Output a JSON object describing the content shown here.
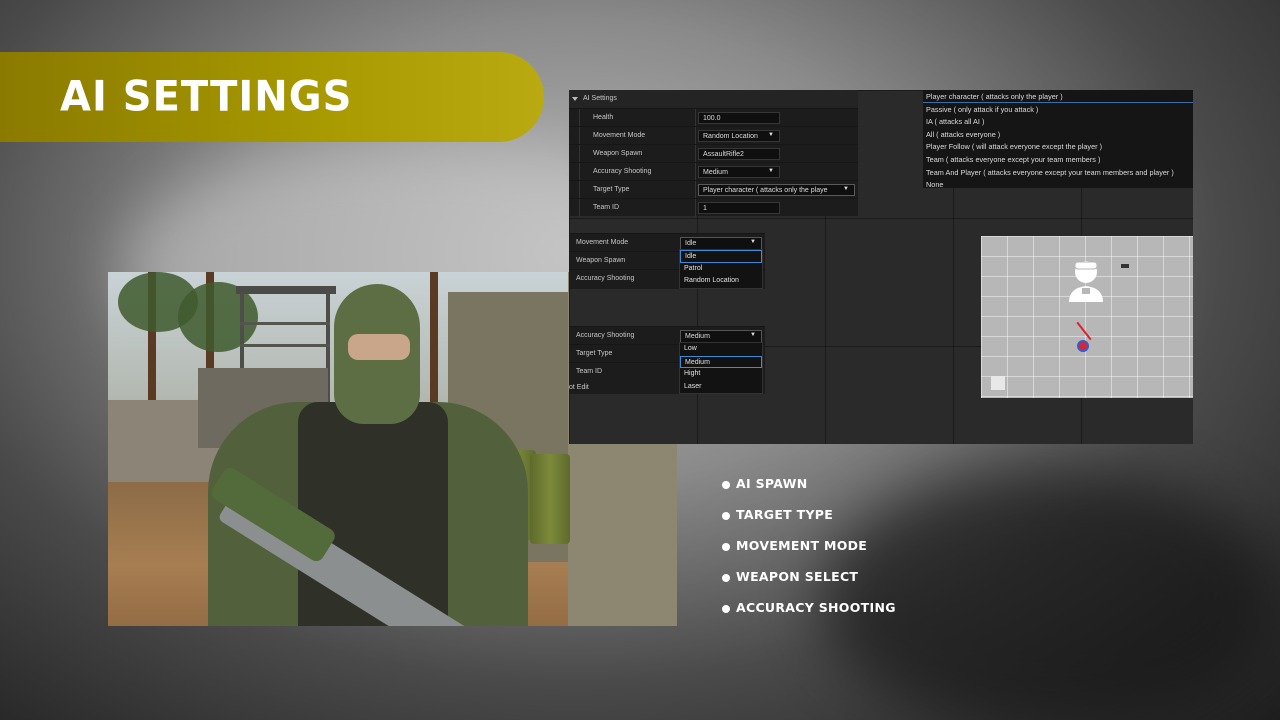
{
  "banner": {
    "title": "AI SETTINGS"
  },
  "details": {
    "header": "AI Settings",
    "rows": [
      {
        "label": "Health",
        "value": "100.0",
        "dropdown": false
      },
      {
        "label": "Movement Mode",
        "value": "Random Location",
        "dropdown": true
      },
      {
        "label": "Weapon Spawn",
        "value": "AssaultRifle2",
        "dropdown": false
      },
      {
        "label": "Accuracy Shooting",
        "value": "Medium",
        "dropdown": true
      },
      {
        "label": "Target Type",
        "value": "Player character ( attacks only the playe",
        "dropdown": true
      },
      {
        "label": "Team ID",
        "value": "1",
        "dropdown": false
      }
    ]
  },
  "target_list": {
    "options": [
      "Player character ( attacks only the player )",
      "Passive (  only attack if you attack )",
      "IA ( attacks all AI )",
      "All ( attacks everyone )",
      "Player Follow ( will attack everyone except the player )",
      "Team ( attacks everyone except your team members )",
      "Team And Player  (  attacks everyone except your team members and player  )",
      "None"
    ],
    "selected_index": 0
  },
  "movement_panel": {
    "rows": [
      "Movement Mode",
      "Weapon Spawn",
      "Accuracy Shooting"
    ],
    "current": "Idle",
    "options": [
      "Idle",
      "Patrol",
      "Random Location"
    ],
    "selected_index": 0
  },
  "accuracy_panel": {
    "rows": [
      "Accuracy Shooting",
      "Target Type",
      "Team ID"
    ],
    "current": "Medium",
    "options": [
      "Low",
      "Medium",
      "Hight",
      "Laser"
    ],
    "selected_index": 1,
    "footer": "ot Edit"
  },
  "features": [
    "AI SPAWN",
    "TARGET TYPE",
    "MOVEMENT MODE",
    "WEAPON SELECT",
    "ACCURACY SHOOTING"
  ],
  "colors": {
    "banner": "#a89a00",
    "editor_bg": "#2a2a2a",
    "selection": "#3d8bd6"
  }
}
